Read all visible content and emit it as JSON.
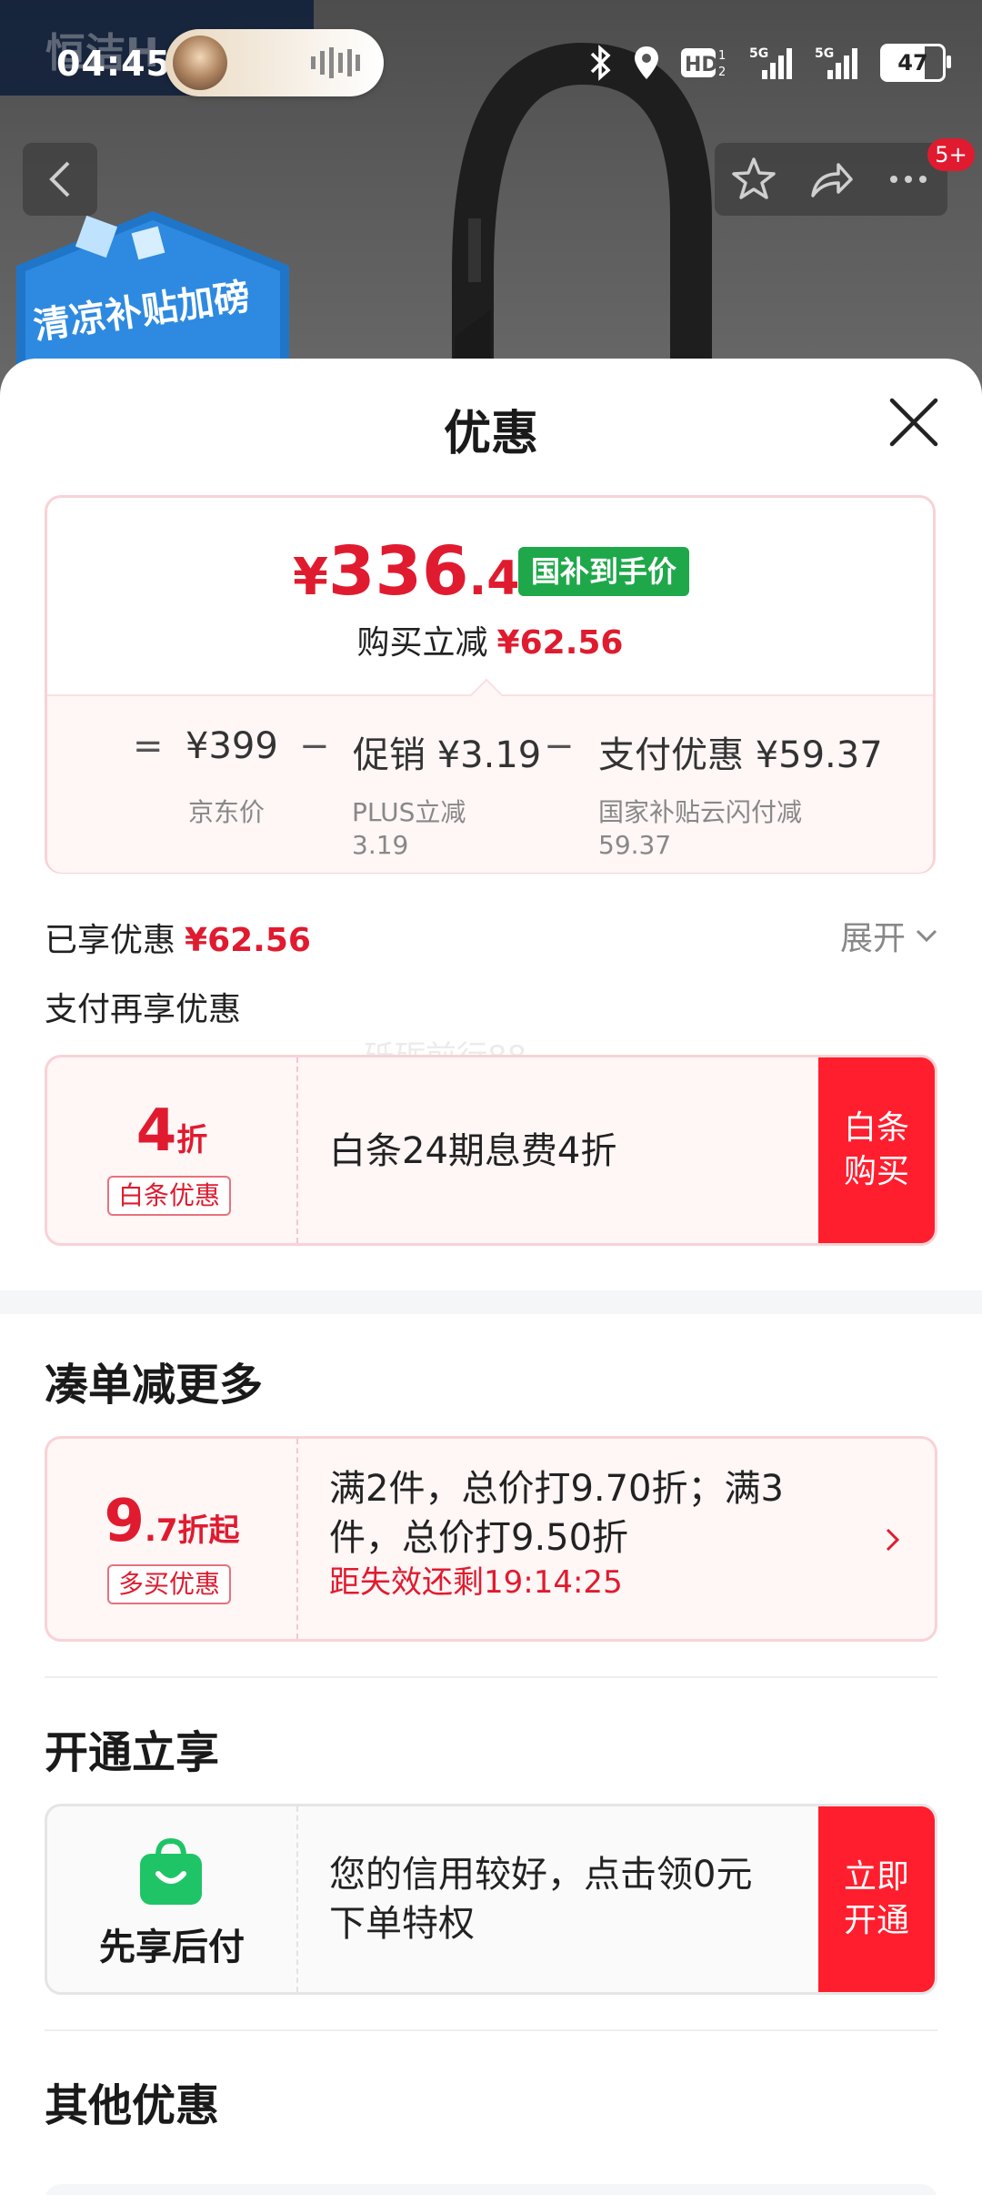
{
  "status_bar": {
    "time": "04:45",
    "battery": "47"
  },
  "header": {
    "background_brand": "恒洁H",
    "promo_badge_text": "清凉补贴加磅",
    "cart_badge": "5+"
  },
  "sheet": {
    "title": "优惠",
    "price_card": {
      "yen": "¥",
      "price_int": "336",
      "price_dec": ".44",
      "gov_tag": "国补到手价",
      "reduce_label": "购买立减",
      "reduce_value": "¥62.56",
      "formula": {
        "eq": "=",
        "jd_price": "¥399",
        "minus1": "−",
        "promo": "促销 ¥3.19",
        "minus2": "−",
        "pay": "支付优惠 ¥59.37"
      },
      "sub_labels": {
        "jd_price_label": "京东价",
        "plus_line1": "PLUS立减",
        "plus_line2": "3.19",
        "gov_line1": "国家补贴云闪付减",
        "gov_line2": "59.37"
      }
    },
    "enjoyed": {
      "label": "已享优惠",
      "value": "¥62.56",
      "expand": "展开"
    },
    "pay_more_label": "支付再享优惠",
    "baitiao_offer": {
      "value_num": "4",
      "value_unit": "折",
      "tag": "白条优惠",
      "desc": "白条24期息费4折",
      "button_line1": "白条",
      "button_line2": "购买"
    },
    "bundle": {
      "section_title": "凑单减更多",
      "value_num": "9",
      "value_rest": ".7折起",
      "tag": "多买优惠",
      "desc_line1": "满2件，总价打9.70折；满3",
      "desc_line2": "件，总价打9.50折",
      "countdown": "距失效还剩19:14:25"
    },
    "activate": {
      "section_title": "开通立享",
      "brand": "先享后付",
      "desc_line1": "您的信用较好，点击领0元",
      "desc_line2": "下单特权",
      "button_line1": "立即",
      "button_line2": "开通"
    },
    "other": {
      "section_title": "其他优惠"
    },
    "watermark": "砥砺前行88"
  },
  "colors": {
    "accent_red": "#e01b2f",
    "button_red": "#ff1e2e",
    "gov_green": "#1fa84a",
    "paylater_green": "#2ecc71"
  }
}
